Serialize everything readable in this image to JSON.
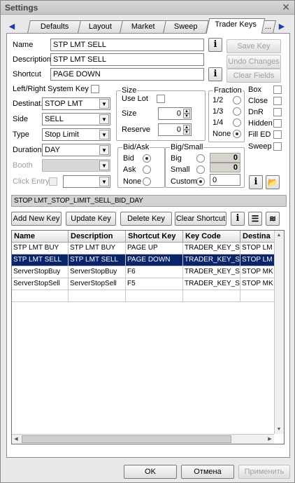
{
  "window": {
    "title": "Settings",
    "close_icon": "close-icon"
  },
  "tabs": [
    "Defaults",
    "Layout",
    "Market",
    "Sweep",
    "Trader Keys"
  ],
  "active_tab": "Trader Keys",
  "form": {
    "name_label": "Name",
    "name_value": "STP LMT SELL",
    "description_label": "Description",
    "description_value": "STP LMT SELL",
    "shortcut_label": "Shortcut",
    "shortcut_value": "PAGE DOWN",
    "lr_system_key_label": "Left/Right System Key",
    "destination_label": "Destinat.",
    "destination_value": "STOP LMT",
    "side_label": "Side",
    "side_value": "SELL",
    "type_label": "Type",
    "type_value": "Stop Limit",
    "duration_label": "Duration",
    "duration_value": "DAY",
    "booth_label": "Booth",
    "booth_value": "",
    "click_entry_label": "Click Entry",
    "click_entry_value": ""
  },
  "buttons": {
    "save_key": "Save Key",
    "undo_changes": "Undo Changes",
    "clear_fields": "Clear Fields",
    "add_new_key": "Add New Key",
    "update_key": "Update Key",
    "delete_key": "Delete Key",
    "clear_shortcut": "Clear Shortcut",
    "info": "i",
    "ok": "OK",
    "cancel": "Отмена",
    "apply": "Применить"
  },
  "size_group": {
    "title": "Size",
    "use_lot_label": "Use Lot",
    "size_label": "Size",
    "size_value": "0",
    "reserve_label": "Reserve",
    "reserve_value": "0"
  },
  "fraction_group": {
    "title": "Fraction",
    "options": [
      "1/2",
      "1/3",
      "1/4",
      "None"
    ],
    "selected": "None"
  },
  "flags": [
    "Box",
    "Close",
    "DnR",
    "Hidden",
    "Fill ED",
    "Sweep"
  ],
  "bid_ask_group": {
    "title": "Bid/Ask",
    "options": [
      "Bid",
      "Ask",
      "None"
    ],
    "selected": "Bid"
  },
  "big_small_group": {
    "title": "Big/Small",
    "options": [
      "Big",
      "Small",
      "Custom"
    ],
    "selected": "Custom",
    "big_value": "0",
    "small_value": "0",
    "custom_value": "0"
  },
  "status_text": "STOP LMT_STOP_LIMIT_SELL_BID_DAY",
  "table": {
    "columns": [
      "Name",
      "Description",
      "Shortcut Key",
      "Key Code",
      "Destina"
    ],
    "rows": [
      [
        "STP LMT BUY",
        "STP LMT BUY",
        "PAGE UP",
        "TRADER_KEY_S",
        "STOP LM"
      ],
      [
        "STP LMT SELL",
        "STP LMT SELL",
        "PAGE DOWN",
        "TRADER_KEY_S",
        "STOP LM"
      ],
      [
        "ServerStopBuy",
        "ServerStopBuy",
        "F6",
        "TRADER_KEY_S",
        "STOP MK"
      ],
      [
        "ServerStopSell",
        "ServerStopSell",
        "F5",
        "TRADER_KEY_S",
        "STOP MK"
      ]
    ],
    "selected_row": 1
  },
  "colors": {
    "selection": "#0a246a",
    "accent": "#1a3fa0"
  }
}
